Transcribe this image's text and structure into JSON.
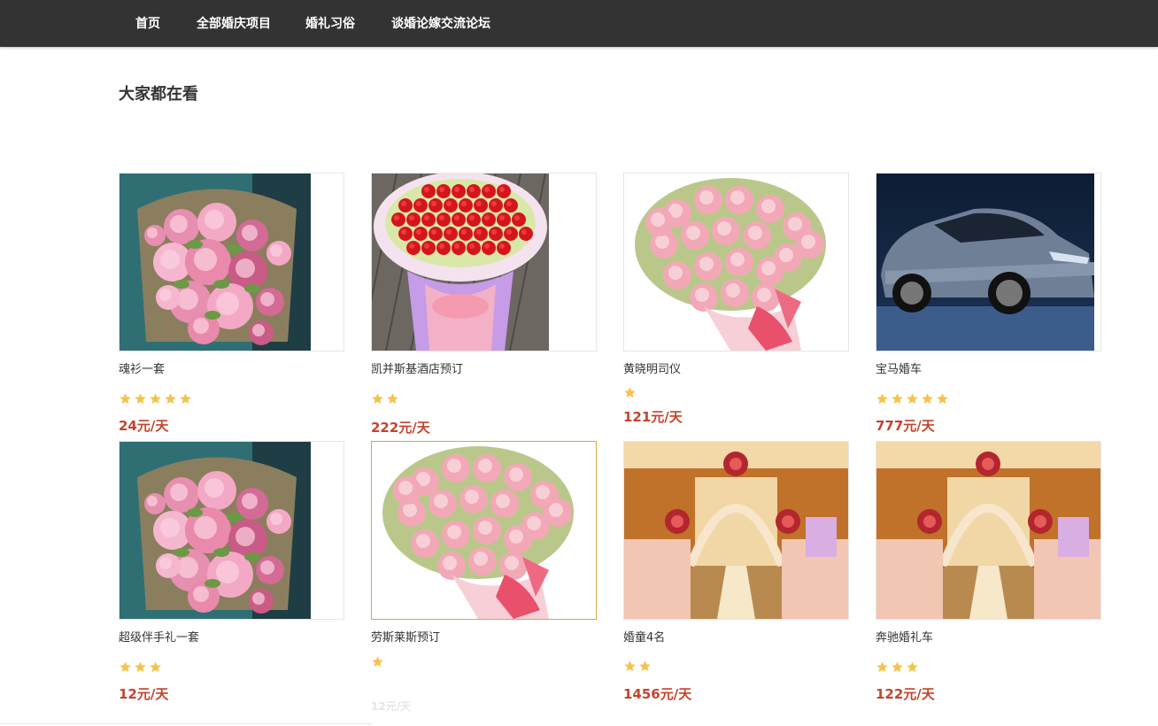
{
  "nav": {
    "items": [
      "首页",
      "全部婚庆项目",
      "婚礼习俗",
      "谈婚论嫁交流论坛"
    ]
  },
  "section": {
    "title": "大家都在看"
  },
  "theme": {
    "nav_bg": "#333333",
    "price_color": "#c5432c",
    "star_color": "#f5c24c",
    "highlight_border": "#d9a740"
  },
  "products": [
    {
      "name": "魂衫一套",
      "rating": 5,
      "price": "24元/天",
      "image": "peony-bouquet"
    },
    {
      "name": "凯并斯基酒店预订",
      "rating": 2,
      "price": "222元/天",
      "image": "red-rose-bouquet"
    },
    {
      "name": "黄晓明司仪",
      "rating": 1,
      "price": "121元/天",
      "image": "pink-carnation-bouquet"
    },
    {
      "name": "宝马婚车",
      "rating": 5,
      "price": "777元/天",
      "image": "blue-suv-car"
    },
    {
      "name": "超级伴手礼一套",
      "rating": 3,
      "price": "12元/天",
      "image": "peony-bouquet"
    },
    {
      "name": "劳斯莱斯预订",
      "rating": 1,
      "price": "12元/天",
      "image": "pink-carnation-bouquet"
    },
    {
      "name": "婚童4名",
      "rating": 2,
      "price": "1456元/天",
      "image": "wedding-hall"
    },
    {
      "name": "奔驰婚礼车",
      "rating": 3,
      "price": "122元/天",
      "image": "wedding-hall"
    }
  ]
}
